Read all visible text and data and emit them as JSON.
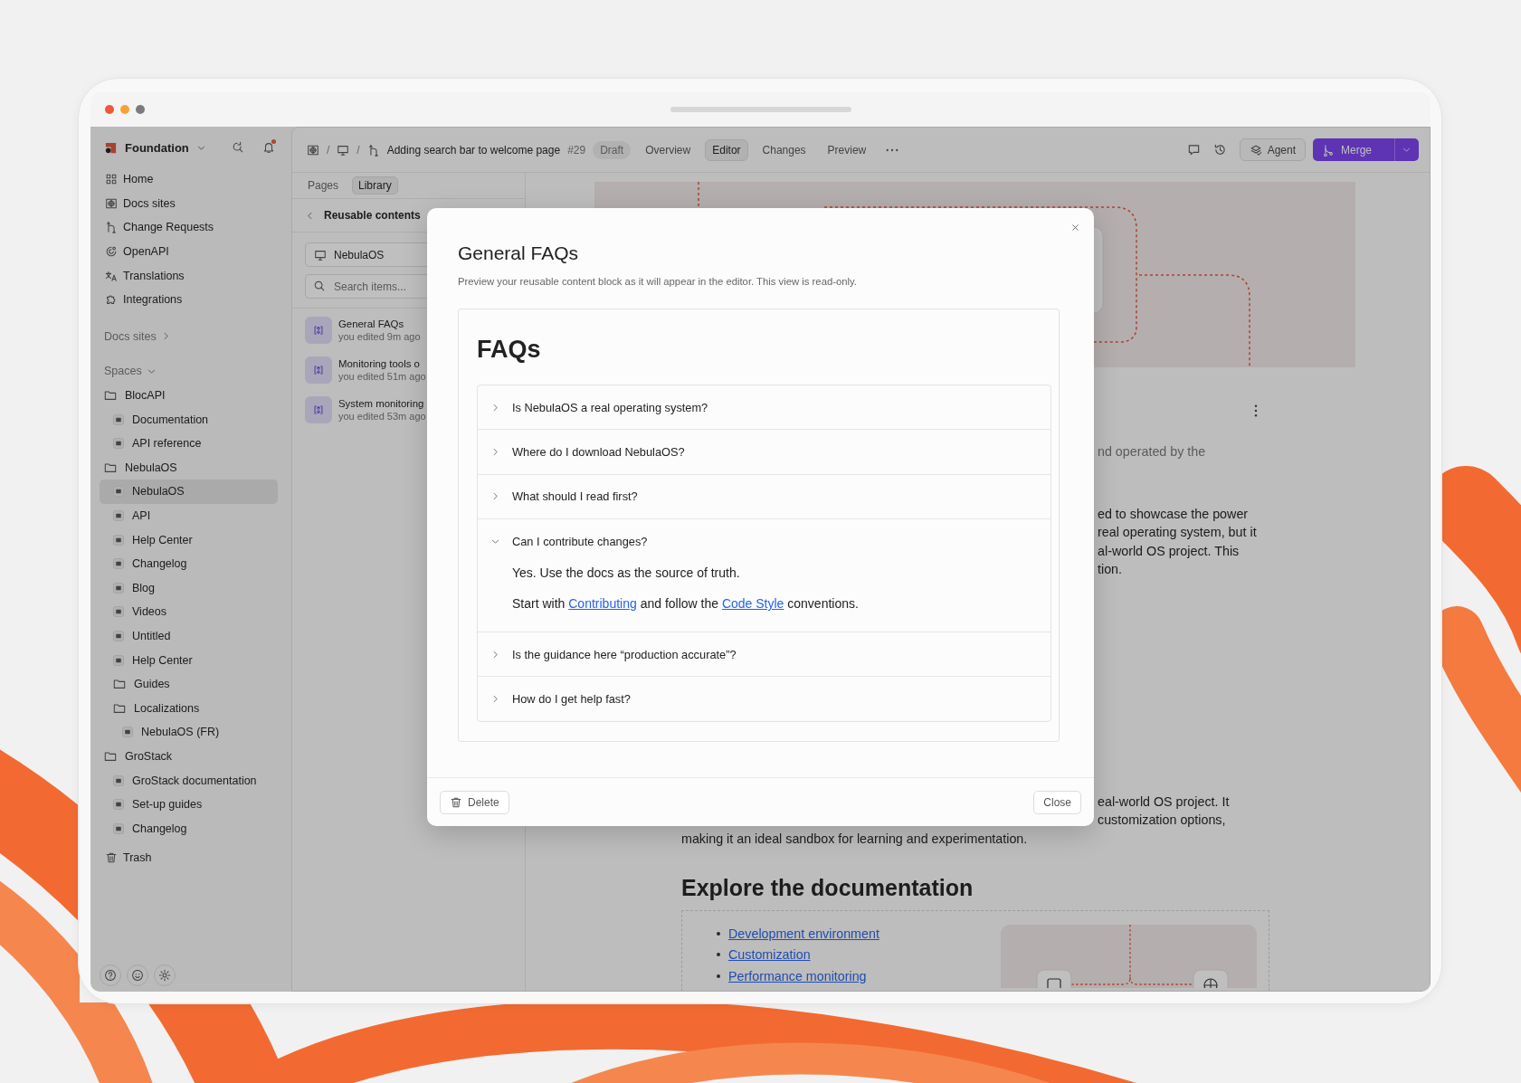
{
  "sidebar": {
    "workspace": "Foundation",
    "notifications": {
      "unread": true
    },
    "nav": [
      {
        "label": "Home",
        "selected": false
      },
      {
        "label": "Docs sites",
        "selected": false
      },
      {
        "label": "Change Requests",
        "selected": false
      },
      {
        "label": "OpenAPI",
        "selected": false
      },
      {
        "label": "Translations",
        "selected": false
      },
      {
        "label": "Integrations",
        "selected": false
      }
    ],
    "docs_sites": "Docs sites",
    "spaces_label": "Spaces",
    "spaces": [
      {
        "label": "BlocAPI",
        "kind": "folder",
        "selected": false,
        "children": [
          {
            "label": "Documentation",
            "kind": "page",
            "selected": false
          },
          {
            "label": "API reference",
            "kind": "page",
            "selected": false
          }
        ]
      },
      {
        "label": "NebulaOS",
        "kind": "folder",
        "selected": false,
        "children": [
          {
            "label": "NebulaOS",
            "kind": "page",
            "selected": true
          },
          {
            "label": "API",
            "kind": "page",
            "selected": false
          },
          {
            "label": "Help Center",
            "kind": "page",
            "selected": false
          },
          {
            "label": "Changelog",
            "kind": "page",
            "selected": false
          },
          {
            "label": "Blog",
            "kind": "page",
            "selected": false
          },
          {
            "label": "Videos",
            "kind": "page",
            "selected": false
          },
          {
            "label": "Untitled",
            "kind": "page",
            "selected": false
          },
          {
            "label": "Help Center",
            "kind": "page",
            "selected": false
          },
          {
            "label": "Guides",
            "kind": "folder",
            "selected": false
          },
          {
            "label": "Localizations",
            "kind": "folder",
            "selected": false,
            "children": [
              {
                "label": "NebulaOS (FR)",
                "kind": "page",
                "selected": false
              }
            ]
          }
        ]
      },
      {
        "label": "GroStack",
        "kind": "folder",
        "selected": false,
        "children": [
          {
            "label": "GroStack documentation",
            "kind": "page",
            "selected": false
          },
          {
            "label": "Set-up guides",
            "kind": "page",
            "selected": false
          },
          {
            "label": "Changelog",
            "kind": "page",
            "selected": false
          }
        ]
      }
    ],
    "trash": "Trash"
  },
  "topbar": {
    "separators": [
      "/",
      "/"
    ],
    "title": "Adding search bar to welcome page",
    "number": "#29",
    "status": "Draft",
    "tabs": [
      {
        "label": "Overview",
        "selected": false
      },
      {
        "label": "Editor",
        "selected": true
      },
      {
        "label": "Changes",
        "selected": false
      },
      {
        "label": "Preview",
        "selected": false
      }
    ],
    "agent_button": "Agent",
    "merge_button": "Merge"
  },
  "library": {
    "tabs": [
      {
        "label": "Pages",
        "selected": false
      },
      {
        "label": "Library",
        "selected": true
      }
    ],
    "header": "Reusable contents",
    "space": "NebulaOS",
    "search": {
      "placeholder": "Search items..."
    },
    "items": [
      {
        "title": "General FAQs",
        "meta": "you edited 9m ago"
      },
      {
        "title": "Monitoring tools o",
        "meta": "you edited 51m ago"
      },
      {
        "title": "System monitoring",
        "meta": "you edited 53m ago"
      }
    ]
  },
  "editor": {
    "intro_fragment": "nd operated by the",
    "paragraph_fragments": [
      "ed to showcase the power",
      "real operating system, but it",
      "al-world OS project. This",
      "tion."
    ],
    "paragraph2_fragments": [
      "eal-world OS project. It",
      "customization options,"
    ],
    "paragraph2_last": "making it an ideal sandbox for learning and experimentation.",
    "heading": "Explore the documentation",
    "links": [
      "Development environment",
      "Customization",
      "Performance monitoring"
    ]
  },
  "modal": {
    "title": "General FAQs",
    "description": "Preview your reusable content block as it will appear in the editor. This view is read-only.",
    "heading": "FAQs",
    "items": [
      {
        "question": "Is NebulaOS a real operating system?",
        "expanded": false
      },
      {
        "question": "Where do I download NebulaOS?",
        "expanded": false
      },
      {
        "question": "What should I read first?",
        "expanded": false
      },
      {
        "question": "Can I contribute changes?",
        "expanded": true,
        "answer": [
          [
            {
              "text": "Yes. Use the docs as the source of truth."
            }
          ],
          [
            {
              "text": "Start with "
            },
            {
              "text": "Contributing",
              "link": true
            },
            {
              "text": " and follow the "
            },
            {
              "text": "Code Style",
              "link": true
            },
            {
              "text": " conventions."
            }
          ]
        ]
      },
      {
        "question": "Is the guidance here “production accurate”?",
        "expanded": false
      },
      {
        "question": "How do I get help fast?",
        "expanded": false
      }
    ],
    "delete_button": "Delete",
    "close_button": "Close"
  }
}
